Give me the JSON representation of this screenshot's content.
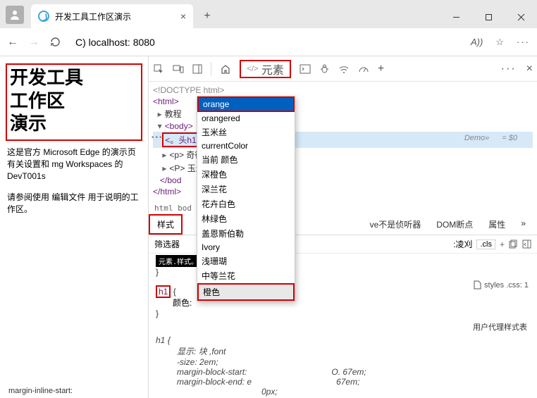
{
  "window": {
    "tab_title": "开发工具工作区演示",
    "url": "C) localhost: 8080",
    "reader_icon": "A))"
  },
  "page": {
    "heading_l1": "开发工具",
    "heading_l2": "工作区",
    "heading_l3": "演示",
    "para1": "这是官方 Microsoft Edge 的演示页 有关设置和 mg Workspaces 的 DevT001s",
    "para2": "请参阅使用 编辑文件 用于说明的工作区。",
    "footer": "margin-inline-start:"
  },
  "devtools": {
    "elements_label": "元素",
    "dom": {
      "doctype": "<!DOCTYPE html>",
      "html_open": "<html>",
      "tutorial": "教程",
      "body": "<body>",
      "h1_sel": "<。头h1",
      "p1": "<p> 奇德珊瑚",
      "p2": "<P> 玉米花-蓝色",
      "bod_close": "</bod",
      "html_close": "</html>",
      "info_demo": "Demo»",
      "info_eq": "= $0"
    },
    "autocomplete": [
      "orange",
      "orangered",
      "",
      "玉米丝",
      "currentColor",
      "当前 颜色",
      "深橙色",
      "深兰花",
      "花卉白色",
      "林绿色",
      "盖恩斯伯勒",
      "Ivory",
      "浅珊瑚",
      "中等兰花",
      "橙色"
    ],
    "breadcrumb": "html bod",
    "tabs2": {
      "styles": "样式",
      "alt1": "ve不是侦听器",
      "alt2": "DOM断点",
      "alt3": "属性"
    },
    "filters": {
      "label": "筛选器",
      "hov": ":凌刈",
      "cls": ".cls"
    },
    "elemstyle": "元素.样式。",
    "rule": {
      "selector": "h1",
      "prop": "颜色:"
    },
    "stylelink": "styles .css: 1",
    "ua_label": "用户代理样式表",
    "ua_rule": {
      "selector": "h1",
      "p1": "显示: 块 ,font",
      "p2": "-size: 2em;",
      "p3": "margin-block-start:",
      "p4": "margin-block-end: e",
      "c1": "O. 67em;",
      "c2": "67em;",
      "c3": "0px;"
    }
  }
}
